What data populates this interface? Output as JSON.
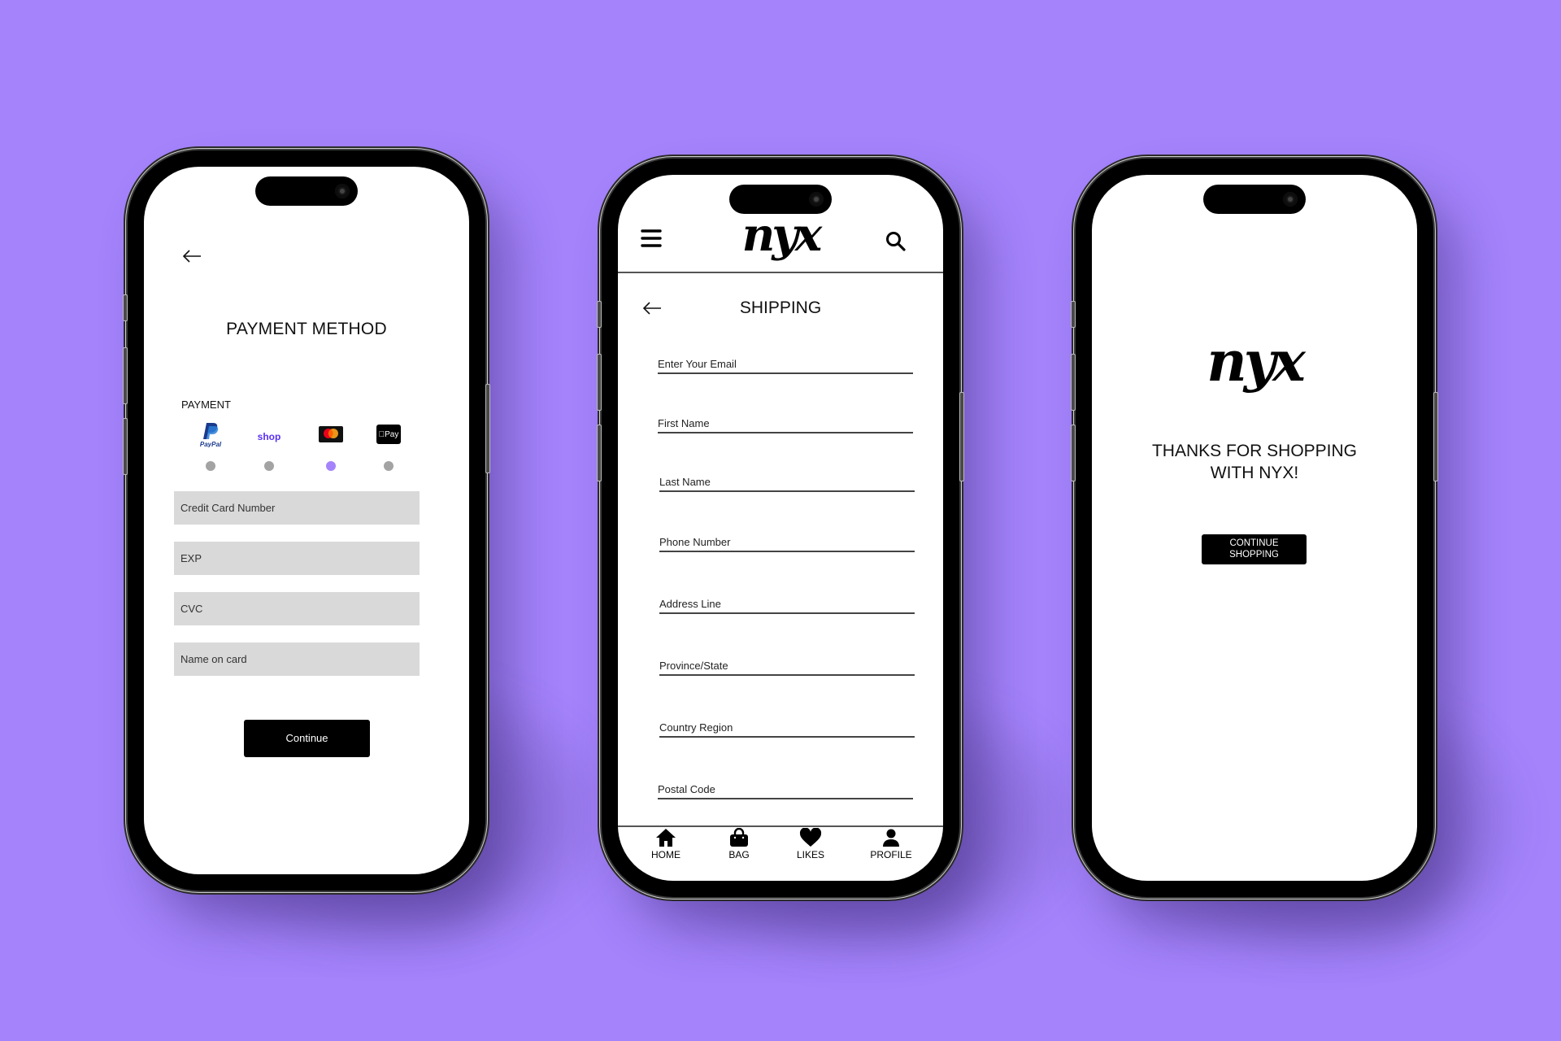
{
  "background_color": "#a483fb",
  "accent_color": "#a483fb",
  "phones": {
    "payment": {
      "title": "PAYMENT METHOD",
      "back_icon": "arrow-left-icon",
      "section_label": "PAYMENT",
      "methods": [
        {
          "name": "PayPal",
          "icon": "paypal-icon",
          "label": "PayPal",
          "selected": false
        },
        {
          "name": "Shop Pay",
          "icon": "shop-pay-icon",
          "label": "shop",
          "selected": false
        },
        {
          "name": "Mastercard",
          "icon": "mastercard-icon",
          "label": "mastercard",
          "selected": true
        },
        {
          "name": "Apple Pay",
          "icon": "apple-pay-icon",
          "label": "Pay",
          "selected": false
        }
      ],
      "fields": [
        {
          "placeholder": "Credit Card Number",
          "value": ""
        },
        {
          "placeholder": "EXP",
          "value": ""
        },
        {
          "placeholder": "CVC",
          "value": ""
        },
        {
          "placeholder": "Name on card",
          "value": ""
        }
      ],
      "continue_label": "Continue"
    },
    "shipping": {
      "logo_text": "nyx",
      "menu_icon": "hamburger-menu-icon",
      "search_icon": "search-icon",
      "title": "SHIPPING",
      "back_icon": "arrow-left-icon",
      "fields": [
        {
          "placeholder": "Enter Your Email",
          "value": ""
        },
        {
          "placeholder": "First Name",
          "value": ""
        },
        {
          "placeholder": "Last Name",
          "value": ""
        },
        {
          "placeholder": "Phone Number",
          "value": ""
        },
        {
          "placeholder": "Address Line",
          "value": ""
        },
        {
          "placeholder": "Province/State",
          "value": ""
        },
        {
          "placeholder": "Country Region",
          "value": ""
        },
        {
          "placeholder": "Postal Code",
          "value": ""
        }
      ],
      "bottom_nav": [
        {
          "label": "HOME",
          "icon": "home-icon"
        },
        {
          "label": "BAG",
          "icon": "shopping-bag-icon"
        },
        {
          "label": "LIKES",
          "icon": "heart-icon"
        },
        {
          "label": "PROFILE",
          "icon": "profile-icon"
        }
      ]
    },
    "confirmation": {
      "logo_text": "nyx",
      "heading_line1": "THANKS FOR SHOPPING",
      "heading_line2": "WITH NYX!",
      "button_line1": "CONTINUE",
      "button_line2": "SHOPPING"
    }
  }
}
